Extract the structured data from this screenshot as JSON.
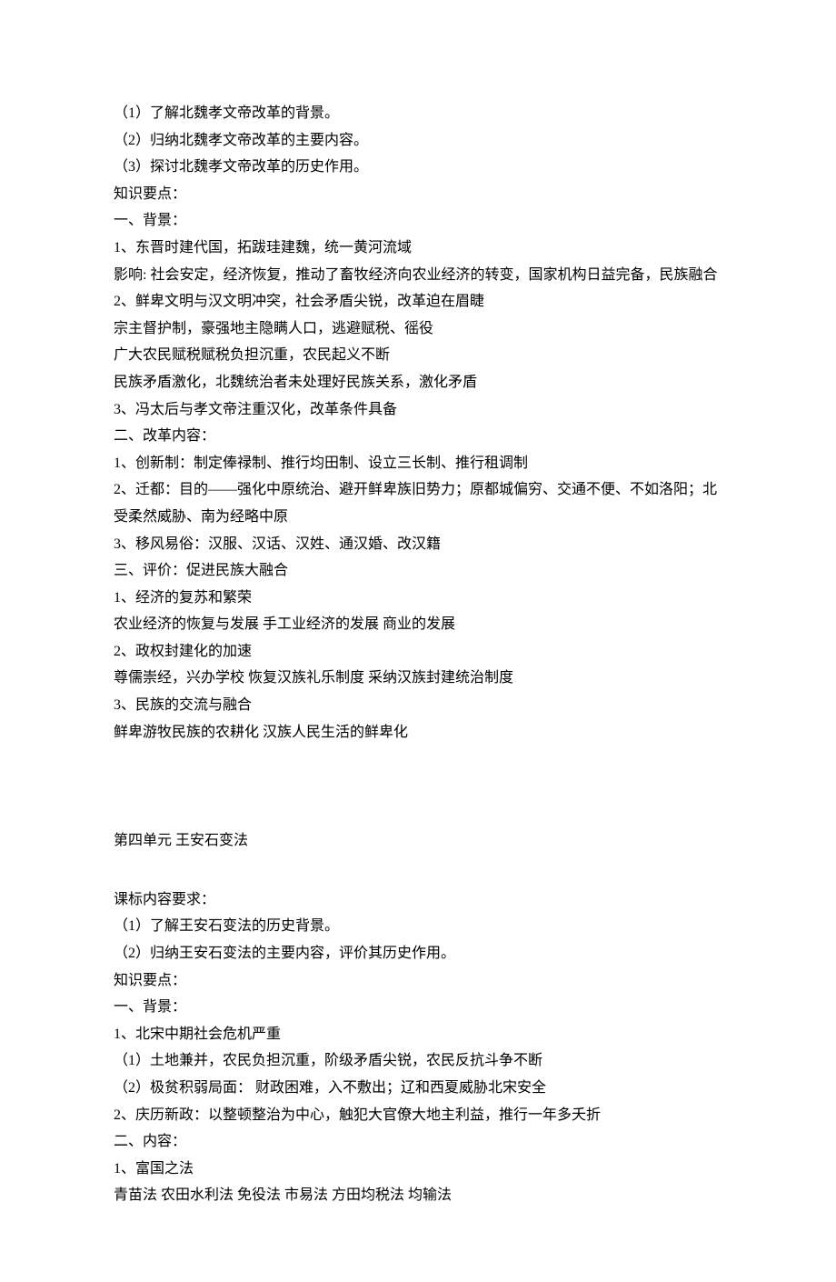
{
  "unit3": {
    "req1": "（1）了解北魏孝文帝改革的背景。",
    "req2": "（2）归纳北魏孝文帝改革的主要内容。",
    "req3": "（3）探讨北魏孝文帝改革的历史作用。",
    "knowledgeLabel": "知识要点：",
    "bg": {
      "title": "一、背景：",
      "p1": "1、东晋时建代国，拓跋珪建魏，统一黄河流域",
      "p1effect": "影响: 社会安定，经济恢复，推动了畜牧经济向农业经济的转变，国家机构日益完备，民族融合",
      "p2": "2、鲜卑文明与汉文明冲突，社会矛盾尖锐，改革迫在眉睫",
      "p2a": "宗主督护制，豪强地主隐瞒人口，逃避赋税、徭役",
      "p2b": "广大农民赋税赋税负担沉重，农民起义不断",
      "p2c": "民族矛盾激化，北魏统治者未处理好民族关系，激化矛盾",
      "p3": "3、冯太后与孝文帝注重汉化，改革条件具备"
    },
    "content": {
      "title": "二、改革内容：",
      "p1": "1、创新制：制定俸禄制、推行均田制、设立三长制、推行租调制",
      "p2": "2、迁都：目的——强化中原统治、避开鲜卑族旧势力；原都城偏穷、交通不便、不如洛阳；北受柔然威胁、南为经略中原",
      "p3": "3、移风易俗：汉服、汉话、汉姓、通汉婚、改汉籍"
    },
    "eval": {
      "title": "三、评价：促进民族大融合",
      "p1": "1、经济的复苏和繁荣",
      "p1a": "农业经济的恢复与发展  手工业经济的发展  商业的发展",
      "p2": "2、政权封建化的加速",
      "p2a": "尊儒崇经，兴办学校  恢复汉族礼乐制度  采纳汉族封建统治制度",
      "p3": "3、民族的交流与融合",
      "p3a": "鲜卑游牧民族的农耕化  汉族人民生活的鲜卑化"
    }
  },
  "unit4": {
    "title": "第四单元  王安石变法",
    "reqLabel": "课标内容要求：",
    "req1": "（1）了解王安石变法的历史背景。",
    "req2": "（2）归纳王安石变法的主要内容，评价其历史作用。",
    "knowledgeLabel": "知识要点：",
    "bg": {
      "title": "一、背景：",
      "p1": "1、北宋中期社会危机严重",
      "p1a": "（1）土地兼并，农民负担沉重，阶级矛盾尖锐，农民反抗斗争不断",
      "p1b": "（2）极贫积弱局面：  财政困难，入不敷出；辽和西夏威胁北宋安全",
      "p2": "2、庆历新政：以整顿整治为中心，触犯大官僚大地主利益，推行一年多夭折"
    },
    "content": {
      "title": "二、内容：",
      "p1": "1、富国之法",
      "p1a": "青苗法  农田水利法  免役法  市易法  方田均税法  均输法"
    }
  }
}
